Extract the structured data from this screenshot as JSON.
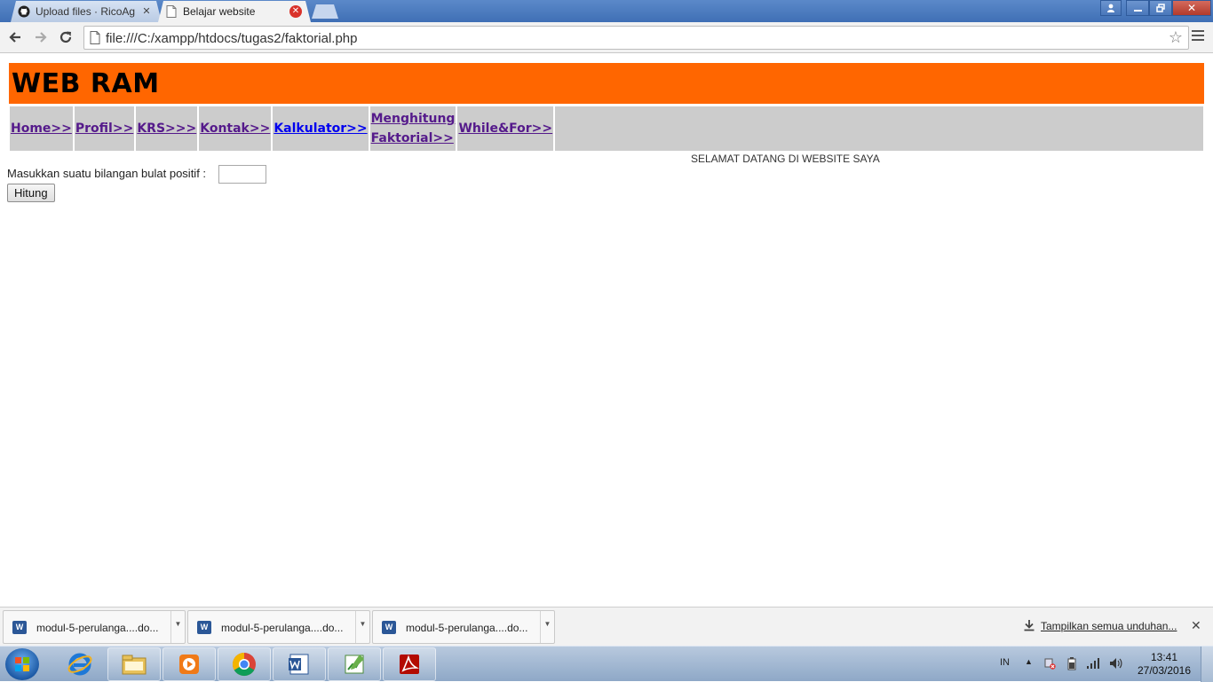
{
  "browser": {
    "tabs": [
      {
        "title": "Upload files · RicoAg",
        "active": false,
        "icon": "github-icon"
      },
      {
        "title": "Belajar website",
        "active": true,
        "icon": "page-icon"
      }
    ],
    "address": "file:///C:/xampp/htdocs/tugas2/faktorial.php"
  },
  "page": {
    "header_title": "WEB RAM",
    "nav": [
      {
        "label": "Home>>",
        "visited": true
      },
      {
        "label": "Profil>>",
        "visited": true
      },
      {
        "label": "KRS>>>",
        "visited": true
      },
      {
        "label": "Kontak>>",
        "visited": true
      },
      {
        "label": "Kalkulator>>",
        "visited": false
      },
      {
        "label": "Menghitung Faktorial>>",
        "visited": true
      },
      {
        "label": "While&For>>",
        "visited": true
      }
    ],
    "welcome": "SELAMAT DATANG DI WEBSITE SAYA",
    "form_label": "Masukkan suatu bilangan bulat positif :",
    "input_value": "",
    "submit_label": "Hitung"
  },
  "downloads": {
    "items": [
      {
        "name": "modul-5-perulanga....do..."
      },
      {
        "name": "modul-5-perulanga....do..."
      },
      {
        "name": "modul-5-perulanga....do..."
      }
    ],
    "show_all": "Tampilkan semua unduhan..."
  },
  "taskbar": {
    "apps": [
      "internet-explorer-icon",
      "file-explorer-icon",
      "media-player-icon",
      "chrome-icon",
      "word-icon",
      "project-icon",
      "acrobat-icon"
    ],
    "language": "IN",
    "time": "13:41",
    "date": "27/03/2016"
  },
  "colors": {
    "header_bg": "#ff6600",
    "nav_bg": "#cccccc",
    "visited_link": "#551a8b",
    "unvisited_link": "#0000ee"
  }
}
